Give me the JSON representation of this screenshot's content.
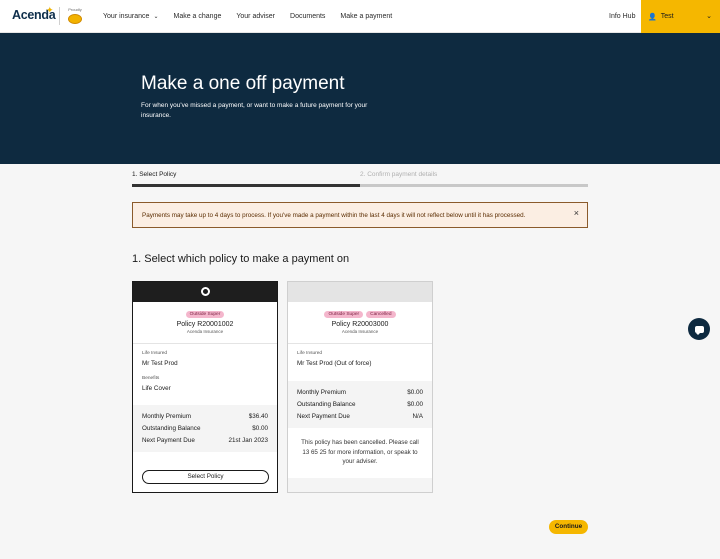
{
  "header": {
    "logo_text": "Acenda",
    "proudly_text": "Proudly",
    "nav": [
      {
        "label": "Your insurance",
        "has_chevron": true
      },
      {
        "label": "Make a change"
      },
      {
        "label": "Your adviser"
      },
      {
        "label": "Documents"
      },
      {
        "label": "Make a payment"
      }
    ],
    "info_hub": "Info Hub",
    "user_name": "Test"
  },
  "hero": {
    "title": "Make a one off payment",
    "subtitle": "For when you've missed a payment, or want to make a future payment for your insurance."
  },
  "stepper": {
    "step1": "1. Select Policy",
    "step2": "2. Confirm payment details",
    "progress": 0.5
  },
  "alert": {
    "text": "Payments may take up to 4 days to process. If you've made a payment within the last 4 days it will not reflect below until it has processed.",
    "close": "×"
  },
  "section_title": "1. Select which policy to make a payment on",
  "cards": [
    {
      "selected": true,
      "badges": [
        "Outside Super"
      ],
      "policy": "Policy R20001002",
      "company": "Acenda Insurance",
      "life_insured_label": "Life Insured",
      "life_insured": "Mr Test Prod",
      "benefits_label": "Benefits",
      "benefits": "Life Cover",
      "rows": [
        {
          "label": "Monthly Premium",
          "value": "$36.40"
        },
        {
          "label": "Outstanding Balance",
          "value": "$0.00"
        },
        {
          "label": "Next Payment Due",
          "value": "21st Jan 2023"
        }
      ],
      "button": "Select Policy"
    },
    {
      "selected": false,
      "badges": [
        "Outside Super",
        "Cancelled"
      ],
      "policy": "Policy R20003000",
      "company": "Acenda Insurance",
      "life_insured_label": "Life Insured",
      "life_insured": "Mr Test Prod (Out of force)",
      "rows": [
        {
          "label": "Monthly Premium",
          "value": "$0.00"
        },
        {
          "label": "Outstanding Balance",
          "value": "$0.00"
        },
        {
          "label": "Next Payment Due",
          "value": "N/A"
        }
      ],
      "note": "This policy has been cancelled. Please call 13 65 25 for more information, or speak to your adviser."
    }
  ],
  "continue_label": "Continue",
  "colors": {
    "hero_bg": "#0e2a40",
    "accent": "#f5b700",
    "alert_bg": "#fbeee3",
    "badge": "#f4b6cc"
  }
}
